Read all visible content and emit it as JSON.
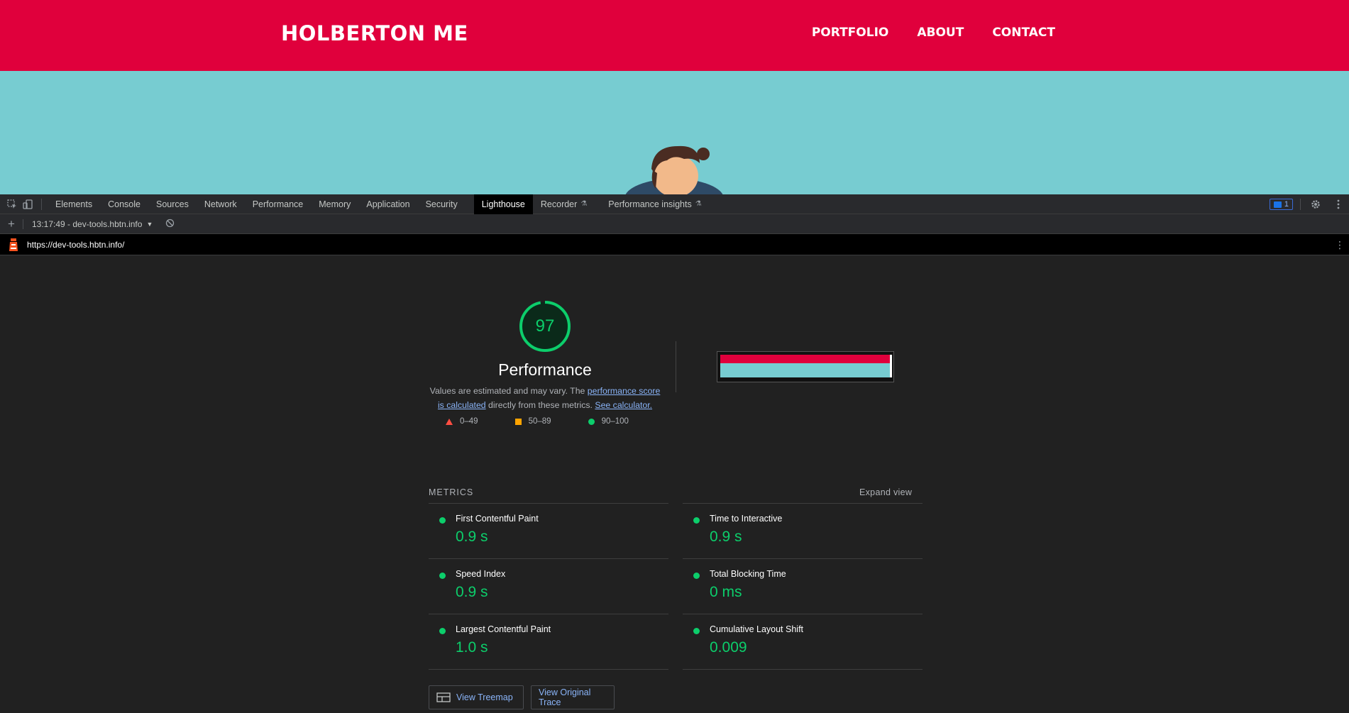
{
  "website": {
    "title": "HOLBERTON ME",
    "nav": [
      "PORTFOLIO",
      "ABOUT",
      "CONTACT"
    ],
    "colors": {
      "header": "#e0003c",
      "hero": "#77ccd1"
    }
  },
  "devtools": {
    "tabs": [
      "Elements",
      "Console",
      "Sources",
      "Network",
      "Performance",
      "Memory",
      "Application",
      "Security",
      "Lighthouse",
      "Recorder",
      "Performance insights"
    ],
    "active_tab": "Lighthouse",
    "issues_count": "1",
    "report_label": "13:17:49 - dev-tools.hbtn.info",
    "url": "https://dev-tools.hbtn.info/"
  },
  "report": {
    "score": "97",
    "category": "Performance",
    "desc_part1": "Values are estimated and may vary. The ",
    "desc_link1": "performance score is calculated",
    "desc_part2": " directly from these metrics. ",
    "desc_link2": "See calculator.",
    "legend": [
      "0–49",
      "50–89",
      "90–100"
    ],
    "metrics_heading": "METRICS",
    "expand_label": "Expand view",
    "metrics": [
      {
        "label": "First Contentful Paint",
        "value": "0.9 s"
      },
      {
        "label": "Time to Interactive",
        "value": "0.9 s"
      },
      {
        "label": "Speed Index",
        "value": "0.9 s"
      },
      {
        "label": "Total Blocking Time",
        "value": "0 ms"
      },
      {
        "label": "Largest Contentful Paint",
        "value": "1.0 s"
      },
      {
        "label": "Cumulative Layout Shift",
        "value": "0.009"
      }
    ],
    "buttons": {
      "treemap": "View Treemap",
      "trace": "View Original Trace"
    },
    "colors": {
      "pass": "#0cce6b",
      "average": "#ffa400",
      "fail": "#ff4e42"
    }
  }
}
